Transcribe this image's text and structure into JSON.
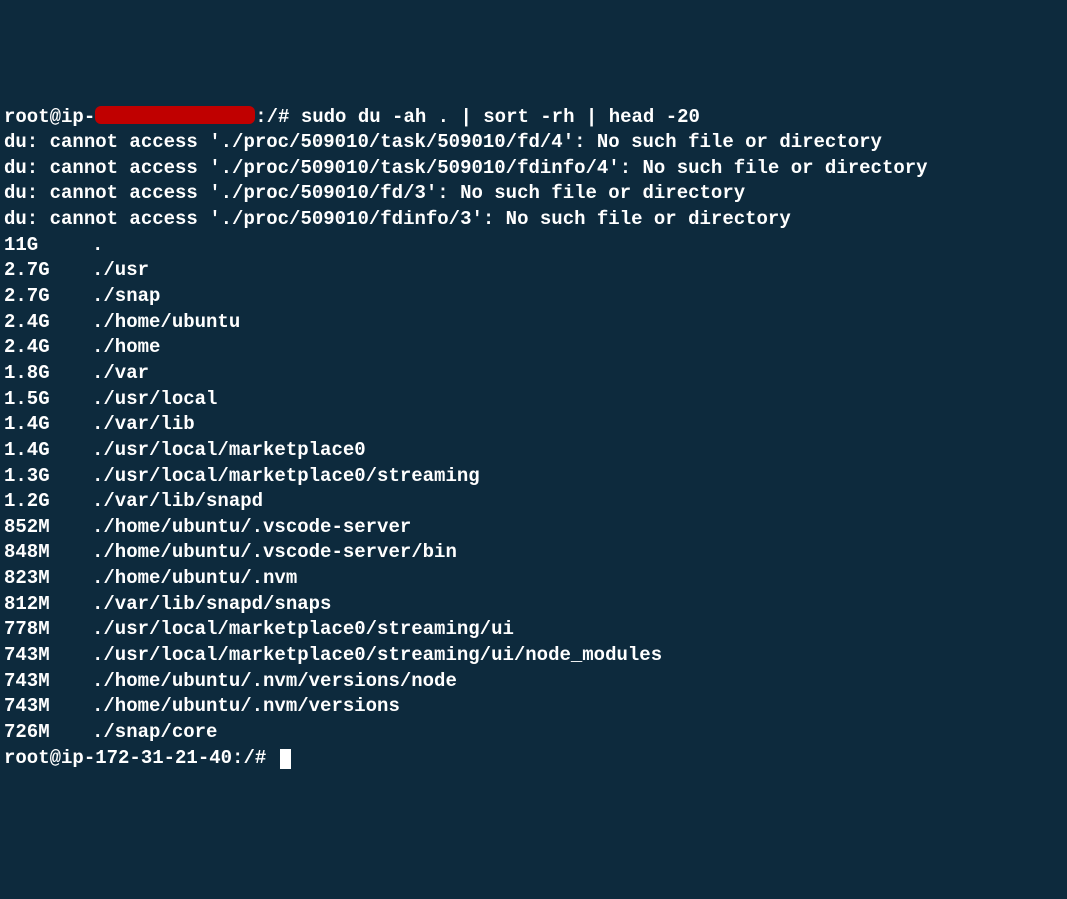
{
  "prompt1": {
    "user_host": "root@ip-",
    "redacted": true,
    "path_suffix": ":/#",
    "command": "sudo du -ah . | sort -rh | head -20"
  },
  "errors": [
    "du: cannot access './proc/509010/task/509010/fd/4': No such file or directory",
    "du: cannot access './proc/509010/task/509010/fdinfo/4': No such file or directory",
    "du: cannot access './proc/509010/fd/3': No such file or directory",
    "du: cannot access './proc/509010/fdinfo/3': No such file or directory"
  ],
  "rows": [
    {
      "size": "11G",
      "path": "."
    },
    {
      "size": "2.7G",
      "path": "./usr"
    },
    {
      "size": "2.7G",
      "path": "./snap"
    },
    {
      "size": "2.4G",
      "path": "./home/ubuntu"
    },
    {
      "size": "2.4G",
      "path": "./home"
    },
    {
      "size": "1.8G",
      "path": "./var"
    },
    {
      "size": "1.5G",
      "path": "./usr/local"
    },
    {
      "size": "1.4G",
      "path": "./var/lib"
    },
    {
      "size": "1.4G",
      "path": "./usr/local/marketplace0"
    },
    {
      "size": "1.3G",
      "path": "./usr/local/marketplace0/streaming"
    },
    {
      "size": "1.2G",
      "path": "./var/lib/snapd"
    },
    {
      "size": "852M",
      "path": "./home/ubuntu/.vscode-server"
    },
    {
      "size": "848M",
      "path": "./home/ubuntu/.vscode-server/bin"
    },
    {
      "size": "823M",
      "path": "./home/ubuntu/.nvm"
    },
    {
      "size": "812M",
      "path": "./var/lib/snapd/snaps"
    },
    {
      "size": "778M",
      "path": "./usr/local/marketplace0/streaming/ui"
    },
    {
      "size": "743M",
      "path": "./usr/local/marketplace0/streaming/ui/node_modules"
    },
    {
      "size": "743M",
      "path": "./home/ubuntu/.nvm/versions/node"
    },
    {
      "size": "743M",
      "path": "./home/ubuntu/.nvm/versions"
    },
    {
      "size": "726M",
      "path": "./snap/core"
    }
  ],
  "prompt2": {
    "full": "root@ip-172-31-21-40:/#"
  }
}
